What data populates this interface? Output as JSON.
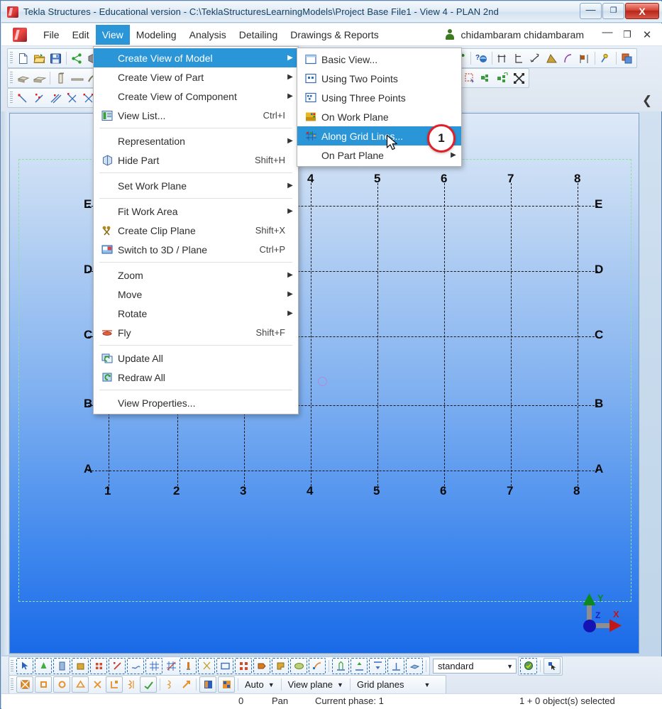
{
  "window": {
    "title": "Tekla Structures - Educational version - C:\\TeklaStructuresLearningModels\\Project Base File1  - View 4 - PLAN 2nd",
    "minimize": "—",
    "maximize": "❐",
    "close": "X"
  },
  "menubar": {
    "items": [
      {
        "label": "File",
        "active": false
      },
      {
        "label": "Edit",
        "active": false
      },
      {
        "label": "View",
        "active": true
      },
      {
        "label": "Modeling",
        "active": false
      },
      {
        "label": "Analysis",
        "active": false
      },
      {
        "label": "Detailing",
        "active": false
      },
      {
        "label": "Drawings & Reports",
        "active": false
      }
    ],
    "user": "chidambaram chidambaram",
    "minimize": "—",
    "restore": "❐",
    "close": "✕"
  },
  "view_menu": {
    "items": [
      {
        "label": "Create View of Model",
        "shortcut": "",
        "submenu": true,
        "selected": true,
        "icon": ""
      },
      {
        "label": "Create View of Part",
        "shortcut": "",
        "submenu": true,
        "selected": false,
        "icon": ""
      },
      {
        "label": "Create View of Component",
        "shortcut": "",
        "submenu": true,
        "selected": false,
        "icon": ""
      },
      {
        "label": "View List...",
        "shortcut": "Ctrl+I",
        "submenu": false,
        "selected": false,
        "icon": "view-list-icon"
      },
      {
        "separator": true
      },
      {
        "label": "Representation",
        "shortcut": "",
        "submenu": true,
        "selected": false,
        "icon": ""
      },
      {
        "label": "Hide Part",
        "shortcut": "Shift+H",
        "submenu": false,
        "selected": false,
        "icon": "hide-part-icon"
      },
      {
        "separator": true
      },
      {
        "label": "Set Work Plane",
        "shortcut": "",
        "submenu": true,
        "selected": false,
        "icon": ""
      },
      {
        "separator": true
      },
      {
        "label": "Fit Work Area",
        "shortcut": "",
        "submenu": true,
        "selected": false,
        "icon": ""
      },
      {
        "label": "Create Clip Plane",
        "shortcut": "Shift+X",
        "submenu": false,
        "selected": false,
        "icon": "clip-plane-icon"
      },
      {
        "label": "Switch to 3D / Plane",
        "shortcut": "Ctrl+P",
        "submenu": false,
        "selected": false,
        "icon": "switch-3d-icon"
      },
      {
        "separator": true
      },
      {
        "label": "Zoom",
        "shortcut": "",
        "submenu": true,
        "selected": false,
        "icon": ""
      },
      {
        "label": "Move",
        "shortcut": "",
        "submenu": true,
        "selected": false,
        "icon": ""
      },
      {
        "label": "Rotate",
        "shortcut": "",
        "submenu": true,
        "selected": false,
        "icon": ""
      },
      {
        "label": "Fly",
        "shortcut": "Shift+F",
        "submenu": false,
        "selected": false,
        "icon": "fly-icon"
      },
      {
        "separator": true
      },
      {
        "label": "Update All",
        "shortcut": "",
        "submenu": false,
        "selected": false,
        "icon": "update-all-icon"
      },
      {
        "label": "Redraw All",
        "shortcut": "",
        "submenu": false,
        "selected": false,
        "icon": "redraw-all-icon"
      },
      {
        "separator": true
      },
      {
        "label": "View Properties...",
        "shortcut": "",
        "submenu": false,
        "selected": false,
        "icon": ""
      }
    ]
  },
  "create_view_submenu": {
    "items": [
      {
        "label": "Basic View...",
        "submenu": false,
        "selected": false,
        "icon": "basic-view-icon"
      },
      {
        "label": "Using Two Points",
        "submenu": false,
        "selected": false,
        "icon": "two-points-icon"
      },
      {
        "label": "Using Three Points",
        "submenu": false,
        "selected": false,
        "icon": "three-points-icon"
      },
      {
        "label": "On Work Plane",
        "submenu": false,
        "selected": false,
        "icon": "work-plane-icon"
      },
      {
        "label": "Along Grid Lines...",
        "submenu": false,
        "selected": true,
        "icon": "grid-lines-icon"
      },
      {
        "label": "On Part Plane",
        "submenu": true,
        "selected": false,
        "icon": ""
      }
    ]
  },
  "callout": {
    "number": "1"
  },
  "model": {
    "grid_columns": [
      "1",
      "2",
      "3",
      "4",
      "5",
      "6",
      "7",
      "8"
    ],
    "grid_rows": [
      "A",
      "B",
      "C",
      "D",
      "E"
    ],
    "axis_labels": {
      "x": "X",
      "y": "Y",
      "z": "Z"
    },
    "workplane_labels": {
      "x": "X",
      "y": "Y",
      "z": "Z"
    }
  },
  "selection_toolbar": {
    "filter_value": "standard",
    "filter_arrow": "▼"
  },
  "snap_toolbar": {
    "auto": "Auto",
    "auto_arrow": "▼",
    "view_plane": "View plane",
    "view_plane_arrow": "▼",
    "grid_planes": "Grid planes",
    "grid_planes_arrow": "▼"
  },
  "statusbar": {
    "coordinate": "0",
    "mode": "Pan",
    "phase": "Current phase: 1",
    "selection": "1 + 0 object(s) selected"
  },
  "colors": {
    "accent": "#2a96d8",
    "callout_red": "#e21f26",
    "title_text": "#16405e",
    "viewport_top": "#dde9f8",
    "viewport_bottom": "#1a6ae8",
    "grid_line": "#161616",
    "workarea_border": "#90e0a0"
  }
}
